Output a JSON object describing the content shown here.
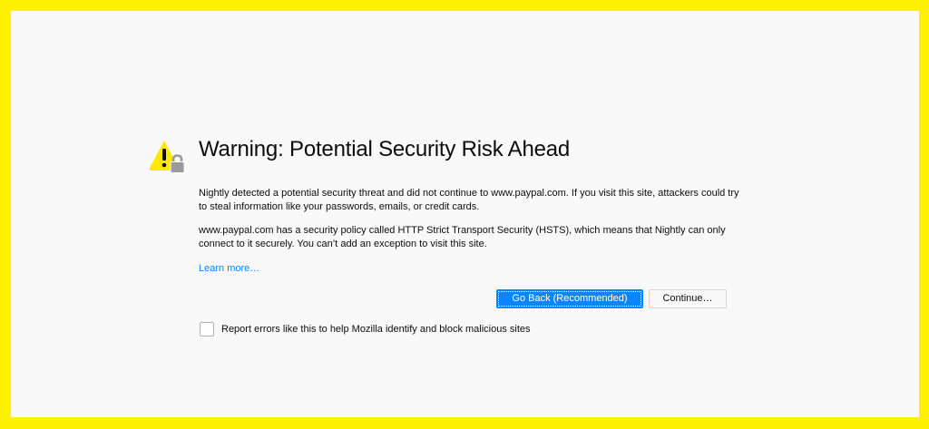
{
  "error_page": {
    "title": "Warning: Potential Security Risk Ahead",
    "description_1": "Nightly detected a potential security threat and did not continue to www.paypal.com. If you visit this site, attackers could try to steal information like your passwords, emails, or credit cards.",
    "description_2": "www.paypal.com has a security policy called HTTP Strict Transport Security (HSTS), which means that Nightly can only connect to it securely. You can’t add an exception to visit this site.",
    "learn_more": "Learn more…",
    "go_back_label": "Go Back (Recommended)",
    "continue_label": "Continue…",
    "report_label": "Report errors like this to help Mozilla identify and block malicious sites",
    "report_checked": false
  },
  "colors": {
    "frame_border": "#fff200",
    "page_background": "#f9f9fa",
    "accent": "#0a84ff",
    "warning_yellow": "#ffe900",
    "text": "#0c0c0d",
    "lock_gray": "#9a9a9d"
  },
  "icons": {
    "warning": "warning-triangle-icon",
    "lock": "lock-icon"
  }
}
